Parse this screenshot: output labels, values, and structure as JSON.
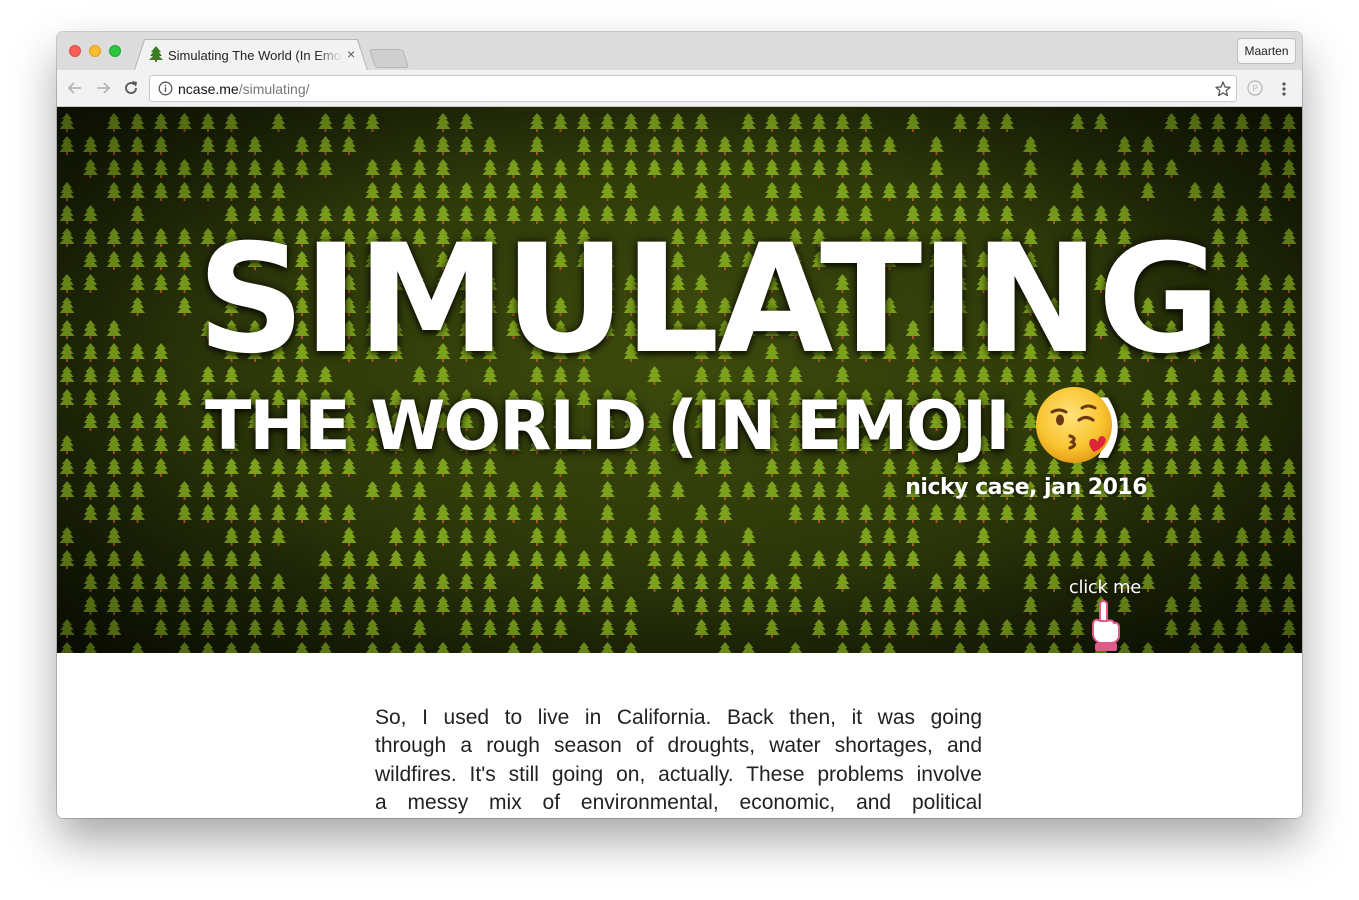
{
  "browser": {
    "tab_title": "Simulating The World (In Emoji 😘)",
    "tab_close": "×",
    "profile_name": "Maarten",
    "url_host": "ncase.me",
    "url_path": "/simulating/",
    "icons": [
      "back-arrow-icon",
      "forward-arrow-icon",
      "reload-icon",
      "info-icon",
      "star-icon",
      "extension-icon",
      "menu-dots-icon",
      "tree-favicon-icon"
    ]
  },
  "hero": {
    "title": "SIMULATING",
    "subtitle": "THE WORLD (IN EMOJI",
    "subtitle_close": ")",
    "author": "nicky case, jan 2016",
    "click_label": "click me",
    "colors": {
      "background": "#2f3a0a",
      "tree": "#7ca11c",
      "text": "#ffffff",
      "hand": "#e05b8b"
    }
  },
  "article": {
    "lines": [
      "So, I used to live in California. Back then, it was going",
      "through a rough season of droughts, water shortages, and",
      "wildfires. It's still going on, actually. These problems involve",
      "a messy mix of environmental, economic, and political"
    ]
  }
}
